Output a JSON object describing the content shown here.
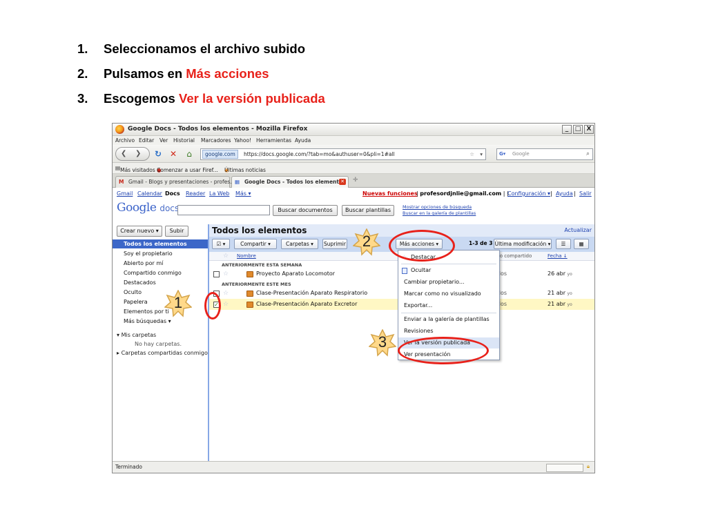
{
  "instructions": [
    {
      "num": "1.",
      "text": "Seleccionamos el archivo subido",
      "highlight": ""
    },
    {
      "num": "2.",
      "text": "Pulsamos en ",
      "highlight": "Más acciones"
    },
    {
      "num": "3.",
      "text": "Escogemos ",
      "highlight": "Ver la versión publicada"
    }
  ],
  "colors": {
    "highlight": "#e8211a",
    "badge_fill": "#ffd98a",
    "badge_stroke": "#d4a44a",
    "link": "#1b3fae",
    "selected_nav": "#3c67c8"
  },
  "window": {
    "title": "Google Docs - Todos los elementos - Mozilla Firefox",
    "buttons": [
      "_",
      "□",
      "X"
    ]
  },
  "menubar": [
    "Archivo",
    "Editar",
    "Ver",
    "Historial",
    "Marcadores",
    "Yahoo!",
    "Herramientas",
    "Ayuda"
  ],
  "navbar": {
    "site": "google.com",
    "url": "https://docs.google.com/?tab=mo&authuser=0&pli=1#all",
    "search_placeholder": "Google"
  },
  "bookmarks": [
    "Más visitados",
    "Comenzar a usar Firef...",
    "Últimas noticias"
  ],
  "tabs": [
    {
      "label": "Gmail - Blogs y presentaciones - profes...",
      "active": false
    },
    {
      "label": "Google Docs - Todos los elementos",
      "active": true
    }
  ],
  "gbar": {
    "links": [
      "Gmail",
      "Calendar",
      "Docs",
      "Reader",
      "La Web",
      "Más ▾"
    ],
    "current": "Docs",
    "news": "Nuevas funciones",
    "email": "profesordjnlie@gmail.com",
    "config": "Configuración ▾",
    "help": "Ayuda",
    "exit": "Salir"
  },
  "search": {
    "logo_google": "Google",
    "logo_docs": "docs",
    "buttons": [
      "Buscar documentos",
      "Buscar plantillas"
    ],
    "options_links": [
      "Mostrar opciones de búsqueda",
      "Buscar en la galería de plantillas"
    ]
  },
  "sidebar": {
    "create_button": "Crear nuevo ▾",
    "upload_button": "Subir",
    "items": [
      "Todos los elementos",
      "Soy el propietario",
      "Abierto por mí",
      "Compartido conmigo",
      "Destacados",
      "Oculto",
      "Papelera",
      "Elementos por ti",
      "Más búsquedas ▾"
    ],
    "selected": "Todos los elementos",
    "folders_title": "Mis carpetas",
    "no_folders": "No hay carpetas.",
    "shared_folders": "Carpetas compartidas conmigo"
  },
  "main": {
    "title": "Todos los elementos",
    "refresh": "Actualizar",
    "toolbar": [
      "☑ ▾",
      "Compartir ▾",
      "Carpetas ▾",
      "Suprimir",
      "Más acciones ▾"
    ],
    "count": "1-3 de 3",
    "sort": "Última modificación ▾",
    "columns": {
      "name": "Nombre",
      "shared": "Uso compartido",
      "date": "Fecha ↓"
    },
    "groups": [
      "ANTERIORMENTE ESTA SEMANA",
      "ANTERIORMENTE ESTE MES"
    ],
    "rows": [
      {
        "name": "Proyecto Aparato Locomotor",
        "shared": "odos",
        "date": "26 abr",
        "who": "yo",
        "checked": false,
        "group": 0
      },
      {
        "name": "Clase-Presentación Aparato Respiratorio",
        "shared": "odos",
        "date": "21 abr",
        "who": "yo",
        "checked": false,
        "group": 1
      },
      {
        "name": "Clase-Presentación Aparato Excretor",
        "shared": "odos",
        "date": "21 abr",
        "who": "yo",
        "checked": true,
        "group": 1
      }
    ]
  },
  "dropdown": {
    "items": [
      "Destacar",
      "Ocultar",
      "Cambiar propietario...",
      "Marcar como no visualizado",
      "Exportar...",
      "Enviar a la galería de plantillas",
      "Revisiones",
      "Ver la versión publicada",
      "Ver presentación"
    ],
    "hovered": "Ver la versión publicada"
  },
  "status": {
    "text": "Terminado"
  },
  "badges": [
    "1",
    "2",
    "3"
  ]
}
